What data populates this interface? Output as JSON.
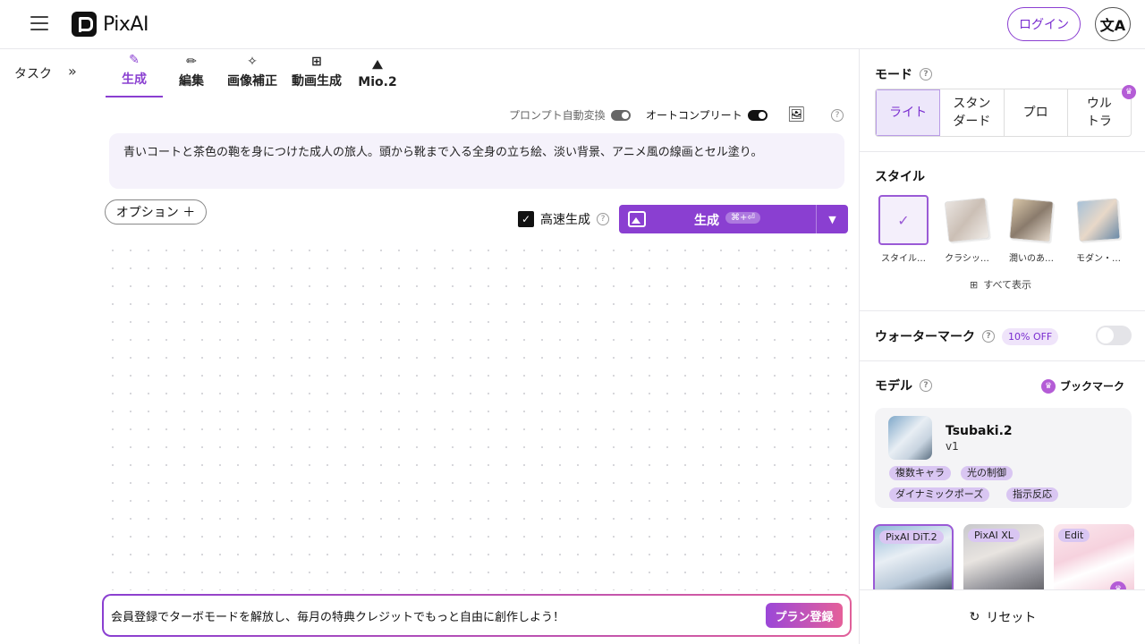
{
  "header": {
    "logo_text": "PixAI",
    "login_label": "ログイン",
    "language_icon": "文A"
  },
  "sidebar": {
    "task_label": "タスク",
    "expand_icon": "»"
  },
  "tabs": [
    {
      "label": "生成",
      "icon": "brush-icon",
      "glyph": "✎"
    },
    {
      "label": "編集",
      "icon": "pencil-icon",
      "glyph": "✏"
    },
    {
      "label": "画像補正",
      "icon": "magic-wand-icon",
      "glyph": "✧"
    },
    {
      "label": "動画生成",
      "icon": "video-plus-icon",
      "glyph": "⊞"
    },
    {
      "label": "Mio.2",
      "icon": "mountain-search-icon",
      "glyph": "⛰"
    }
  ],
  "options": {
    "auto_translate_label": "プロンプト自動変換",
    "autocomplete_label": "オートコンプリート",
    "help": "?"
  },
  "prompt": {
    "text": "青いコートと茶色の鞄を身につけた成人の旅人。頭から靴まで入る全身の立ち絵、淡い背景、アニメ風の線画とセル塗り。"
  },
  "controls": {
    "option_label": "オプション ＋",
    "fast_label": "高速生成",
    "generate_label": "生成",
    "generate_shortcut": "⌘+⏎"
  },
  "promo": {
    "text": "会員登録でターボモードを解放し、毎月の特典クレジットでもっと自由に創作しよう！",
    "button": "プラン登録"
  },
  "panel": {
    "mode_title": "モード",
    "modes": [
      "ライト",
      "スタン\nダード",
      "プロ",
      "ウル\nトラ"
    ],
    "style_title": "スタイル",
    "styles": [
      "スタイル…",
      "クラシッ…",
      "潤いのあ…",
      "モダン・…"
    ],
    "show_all": "すべて表示",
    "watermark_title": "ウォーターマーク",
    "watermark_badge": "10% OFF",
    "model_title": "モデル",
    "bookmark_label": "ブックマーク",
    "model": {
      "name": "Tsubaki.2",
      "version": "v1",
      "tags": [
        "複数キャラ",
        "光の制御",
        "ダイナミックポーズ",
        "指示反応"
      ]
    },
    "model_thumbs": [
      "PixAI DiT.2",
      "PixAI XL",
      "Edit"
    ],
    "reset_label": "リセット"
  },
  "colors": {
    "accent": "#8a3fd1",
    "accent_light": "#ede7fa",
    "promo_gradient_end": "#e0609a"
  }
}
